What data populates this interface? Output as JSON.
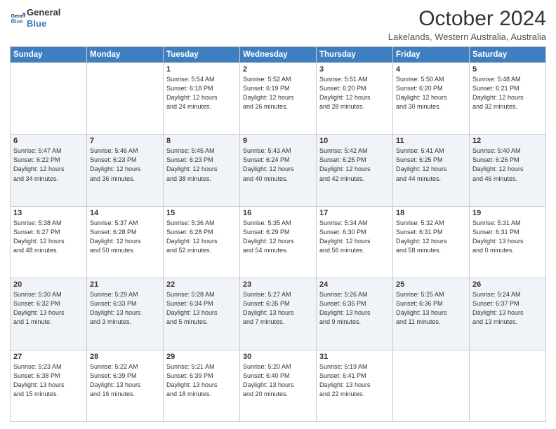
{
  "header": {
    "logo_line1": "General",
    "logo_line2": "Blue",
    "month_title": "October 2024",
    "location": "Lakelands, Western Australia, Australia"
  },
  "days_of_week": [
    "Sunday",
    "Monday",
    "Tuesday",
    "Wednesday",
    "Thursday",
    "Friday",
    "Saturday"
  ],
  "weeks": [
    [
      {
        "day": "",
        "info": ""
      },
      {
        "day": "",
        "info": ""
      },
      {
        "day": "1",
        "info": "Sunrise: 5:54 AM\nSunset: 6:18 PM\nDaylight: 12 hours\nand 24 minutes."
      },
      {
        "day": "2",
        "info": "Sunrise: 5:52 AM\nSunset: 6:19 PM\nDaylight: 12 hours\nand 26 minutes."
      },
      {
        "day": "3",
        "info": "Sunrise: 5:51 AM\nSunset: 6:20 PM\nDaylight: 12 hours\nand 28 minutes."
      },
      {
        "day": "4",
        "info": "Sunrise: 5:50 AM\nSunset: 6:20 PM\nDaylight: 12 hours\nand 30 minutes."
      },
      {
        "day": "5",
        "info": "Sunrise: 5:48 AM\nSunset: 6:21 PM\nDaylight: 12 hours\nand 32 minutes."
      }
    ],
    [
      {
        "day": "6",
        "info": "Sunrise: 5:47 AM\nSunset: 6:22 PM\nDaylight: 12 hours\nand 34 minutes."
      },
      {
        "day": "7",
        "info": "Sunrise: 5:46 AM\nSunset: 6:23 PM\nDaylight: 12 hours\nand 36 minutes."
      },
      {
        "day": "8",
        "info": "Sunrise: 5:45 AM\nSunset: 6:23 PM\nDaylight: 12 hours\nand 38 minutes."
      },
      {
        "day": "9",
        "info": "Sunrise: 5:43 AM\nSunset: 6:24 PM\nDaylight: 12 hours\nand 40 minutes."
      },
      {
        "day": "10",
        "info": "Sunrise: 5:42 AM\nSunset: 6:25 PM\nDaylight: 12 hours\nand 42 minutes."
      },
      {
        "day": "11",
        "info": "Sunrise: 5:41 AM\nSunset: 6:25 PM\nDaylight: 12 hours\nand 44 minutes."
      },
      {
        "day": "12",
        "info": "Sunrise: 5:40 AM\nSunset: 6:26 PM\nDaylight: 12 hours\nand 46 minutes."
      }
    ],
    [
      {
        "day": "13",
        "info": "Sunrise: 5:38 AM\nSunset: 6:27 PM\nDaylight: 12 hours\nand 48 minutes."
      },
      {
        "day": "14",
        "info": "Sunrise: 5:37 AM\nSunset: 6:28 PM\nDaylight: 12 hours\nand 50 minutes."
      },
      {
        "day": "15",
        "info": "Sunrise: 5:36 AM\nSunset: 6:28 PM\nDaylight: 12 hours\nand 52 minutes."
      },
      {
        "day": "16",
        "info": "Sunrise: 5:35 AM\nSunset: 6:29 PM\nDaylight: 12 hours\nand 54 minutes."
      },
      {
        "day": "17",
        "info": "Sunrise: 5:34 AM\nSunset: 6:30 PM\nDaylight: 12 hours\nand 56 minutes."
      },
      {
        "day": "18",
        "info": "Sunrise: 5:32 AM\nSunset: 6:31 PM\nDaylight: 12 hours\nand 58 minutes."
      },
      {
        "day": "19",
        "info": "Sunrise: 5:31 AM\nSunset: 6:31 PM\nDaylight: 13 hours\nand 0 minutes."
      }
    ],
    [
      {
        "day": "20",
        "info": "Sunrise: 5:30 AM\nSunset: 6:32 PM\nDaylight: 13 hours\nand 1 minute."
      },
      {
        "day": "21",
        "info": "Sunrise: 5:29 AM\nSunset: 6:33 PM\nDaylight: 13 hours\nand 3 minutes."
      },
      {
        "day": "22",
        "info": "Sunrise: 5:28 AM\nSunset: 6:34 PM\nDaylight: 13 hours\nand 5 minutes."
      },
      {
        "day": "23",
        "info": "Sunrise: 5:27 AM\nSunset: 6:35 PM\nDaylight: 13 hours\nand 7 minutes."
      },
      {
        "day": "24",
        "info": "Sunrise: 5:26 AM\nSunset: 6:35 PM\nDaylight: 13 hours\nand 9 minutes."
      },
      {
        "day": "25",
        "info": "Sunrise: 5:25 AM\nSunset: 6:36 PM\nDaylight: 13 hours\nand 11 minutes."
      },
      {
        "day": "26",
        "info": "Sunrise: 5:24 AM\nSunset: 6:37 PM\nDaylight: 13 hours\nand 13 minutes."
      }
    ],
    [
      {
        "day": "27",
        "info": "Sunrise: 5:23 AM\nSunset: 6:38 PM\nDaylight: 13 hours\nand 15 minutes."
      },
      {
        "day": "28",
        "info": "Sunrise: 5:22 AM\nSunset: 6:39 PM\nDaylight: 13 hours\nand 16 minutes."
      },
      {
        "day": "29",
        "info": "Sunrise: 5:21 AM\nSunset: 6:39 PM\nDaylight: 13 hours\nand 18 minutes."
      },
      {
        "day": "30",
        "info": "Sunrise: 5:20 AM\nSunset: 6:40 PM\nDaylight: 13 hours\nand 20 minutes."
      },
      {
        "day": "31",
        "info": "Sunrise: 5:19 AM\nSunset: 6:41 PM\nDaylight: 13 hours\nand 22 minutes."
      },
      {
        "day": "",
        "info": ""
      },
      {
        "day": "",
        "info": ""
      }
    ]
  ]
}
